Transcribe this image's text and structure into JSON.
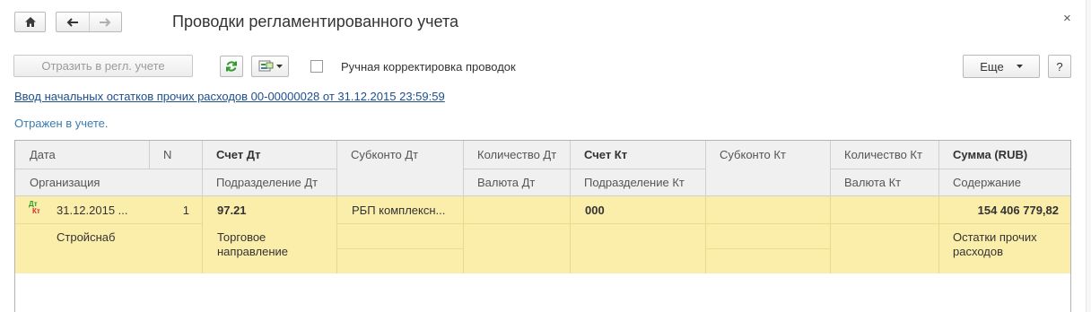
{
  "window": {
    "title": "Проводки регламентированного учета",
    "close_glyph": "×"
  },
  "nav": {
    "home_icon": "home-icon",
    "back_icon": "arrow-left-icon",
    "forward_icon": "arrow-right-icon"
  },
  "toolbar": {
    "post_label": "Отразить в регл. учете",
    "refresh_icon": "refresh-icon",
    "report_icon": "report-dropdown-icon",
    "manual_label": "Ручная корректировка проводок",
    "manual_checked": false,
    "more_label": "Еще",
    "help_label": "?"
  },
  "document_link": "Ввод начальных остатков прочих расходов 00-00000028 от 31.12.2015 23:59:59",
  "status": "Отражен в учете.",
  "columns": {
    "date": "Дата",
    "n": "N",
    "account_dt": "Счет Дт",
    "subconto_dt": "Субконто Дт",
    "qty_dt": "Количество Дт",
    "account_kt": "Счет Кт",
    "subconto_kt": "Субконто Кт",
    "qty_kt": "Количество Кт",
    "amount": "Сумма (RUB)",
    "org": "Организация",
    "dept_dt": "Подразделение Дт",
    "currency_dt": "Валюта Дт",
    "dept_kt": "Подразделение Кт",
    "currency_kt": "Валюта Кт",
    "content": "Содержание"
  },
  "rows": [
    {
      "icon_top": "Дт",
      "icon_bottom": "Кт",
      "date": "31.12.2015 ...",
      "n": "1",
      "account_dt": "97.21",
      "subconto_dt": "РБП комплексн...",
      "account_kt": "000",
      "amount": "154 406 779,82",
      "org": "Стройснаб",
      "dept_dt": "Торговое направление",
      "content": "Остатки прочих расходов"
    }
  ],
  "colors": {
    "selected_row": "#fbeeab",
    "header_bg": "#f0f0f0",
    "link": "#1c4f8c",
    "status": "#3a7db0",
    "refresh_green": "#2e9a2e"
  }
}
